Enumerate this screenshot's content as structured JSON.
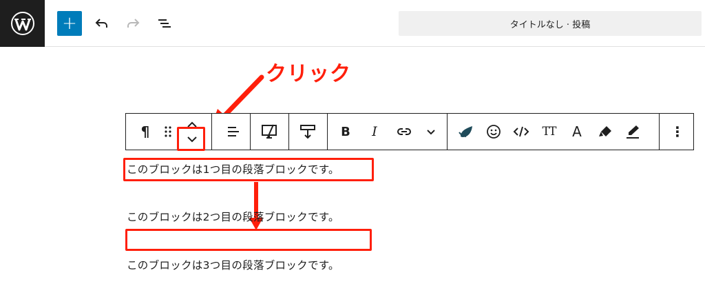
{
  "topbar": {
    "add_label": "+",
    "doc_title": "タイトルなし · 投稿"
  },
  "annotation": {
    "label": "クリック"
  },
  "block_toolbar": {
    "paragraph_symbol": "¶",
    "bold": "B",
    "italic": "I",
    "text_size": "TT",
    "font_letter": "A",
    "more": "⋮"
  },
  "paragraphs": [
    "このブロックは1つ目の段落ブロックです。",
    "このブロックは2つ目の段落ブロックです。",
    "このブロックは3つ目の段落ブロックです。"
  ],
  "colors": {
    "annotation_red": "#ff1f0b",
    "wp_dark": "#1e1e1e",
    "wp_blue": "#007cba",
    "title_bg": "#f0f0f0"
  }
}
